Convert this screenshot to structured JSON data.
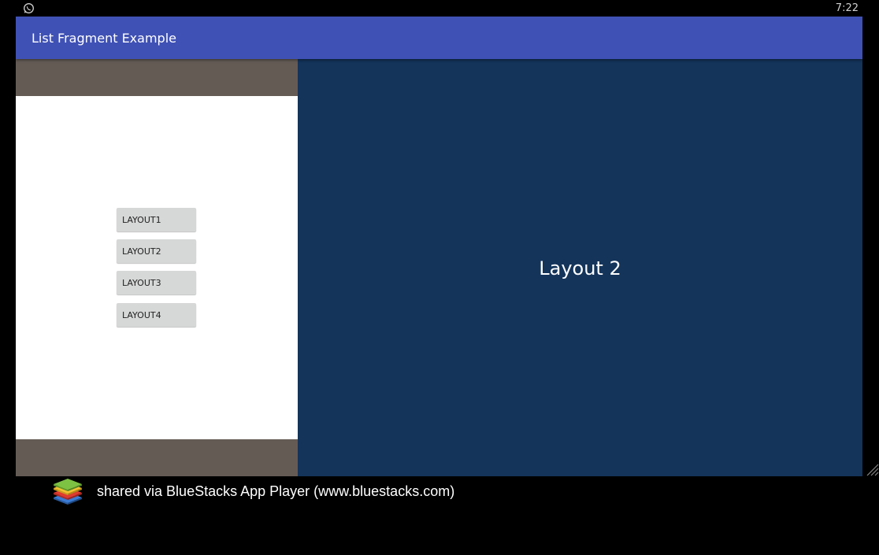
{
  "status_bar": {
    "time": "7:22",
    "notification_icon": "whatsapp-icon"
  },
  "app_bar": {
    "title": "List Fragment Example",
    "color": "#3f51b5"
  },
  "list_fragment": {
    "buttons": [
      {
        "label": "LAYOUT1"
      },
      {
        "label": "LAYOUT2"
      },
      {
        "label": "LAYOUT3"
      },
      {
        "label": "LAYOUT4"
      }
    ]
  },
  "detail_fragment": {
    "label": "Layout 2",
    "background": "#14345a"
  },
  "share_bar": {
    "text": "shared via BlueStacks App Player (www.bluestacks.com)",
    "logo_icon": "bluestacks-logo"
  }
}
